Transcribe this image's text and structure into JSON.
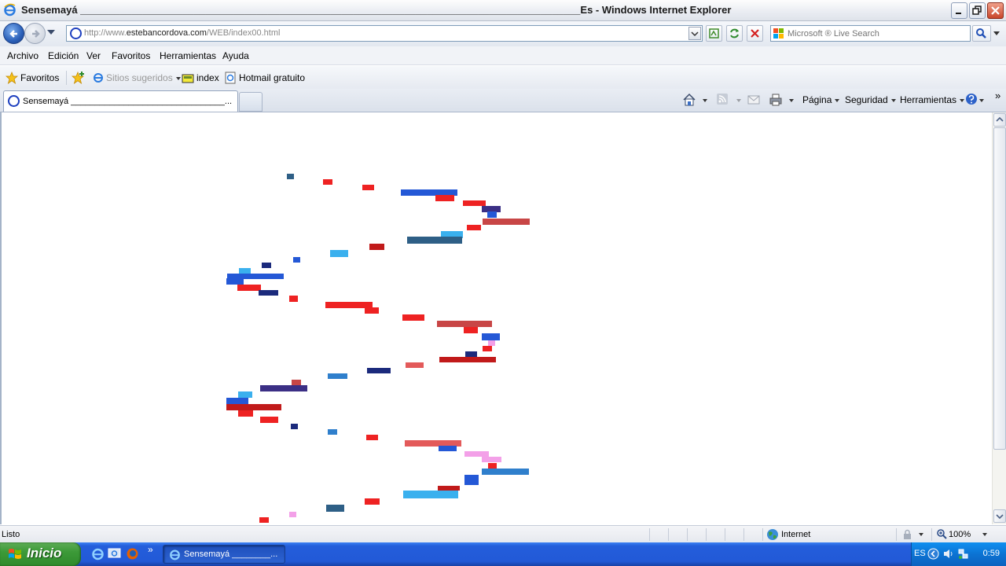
{
  "window": {
    "title": "Sensemayá ________________________________________________________________________________________Es - Windows Internet Explorer"
  },
  "address_bar": {
    "url_prefix": "http://www.",
    "url_domain": "estebancordova.com",
    "url_path": "/WEB/index00.html",
    "search_placeholder": "Microsoft ® Live Search"
  },
  "menu": {
    "items": [
      "Archivo",
      "Edición",
      "Ver",
      "Favoritos",
      "Herramientas",
      "Ayuda"
    ]
  },
  "favorites_bar": {
    "favorites_label": "Favoritos",
    "suggested_label": "Sitios sugeridos",
    "items": [
      "index",
      "Hotmail gratuito"
    ]
  },
  "tabs": {
    "active_label": "Sensemayá ________________________________..."
  },
  "command_bar": {
    "page_label": "Página",
    "security_label": "Seguridad",
    "tools_label": "Herramientas"
  },
  "status_bar": {
    "status": "Listo",
    "zone": "Internet",
    "zoom": "100%"
  },
  "taskbar": {
    "start_label": "Inicio",
    "task_label": "Sensemayá ________...",
    "language": "ES",
    "clock": "0:59"
  },
  "colors": {
    "red": "#ee2222",
    "dark_red": "#c11a1a",
    "brick": "#c84646",
    "salmon": "#e35a5a",
    "navy": "#1b2a7c",
    "blue": "#2458d6",
    "sky": "#3ab0ee",
    "steel": "#2e5f86",
    "purple": "#3b2f85",
    "pink": "#f3a0e8",
    "mid_blue": "#2f7fcc"
  }
}
